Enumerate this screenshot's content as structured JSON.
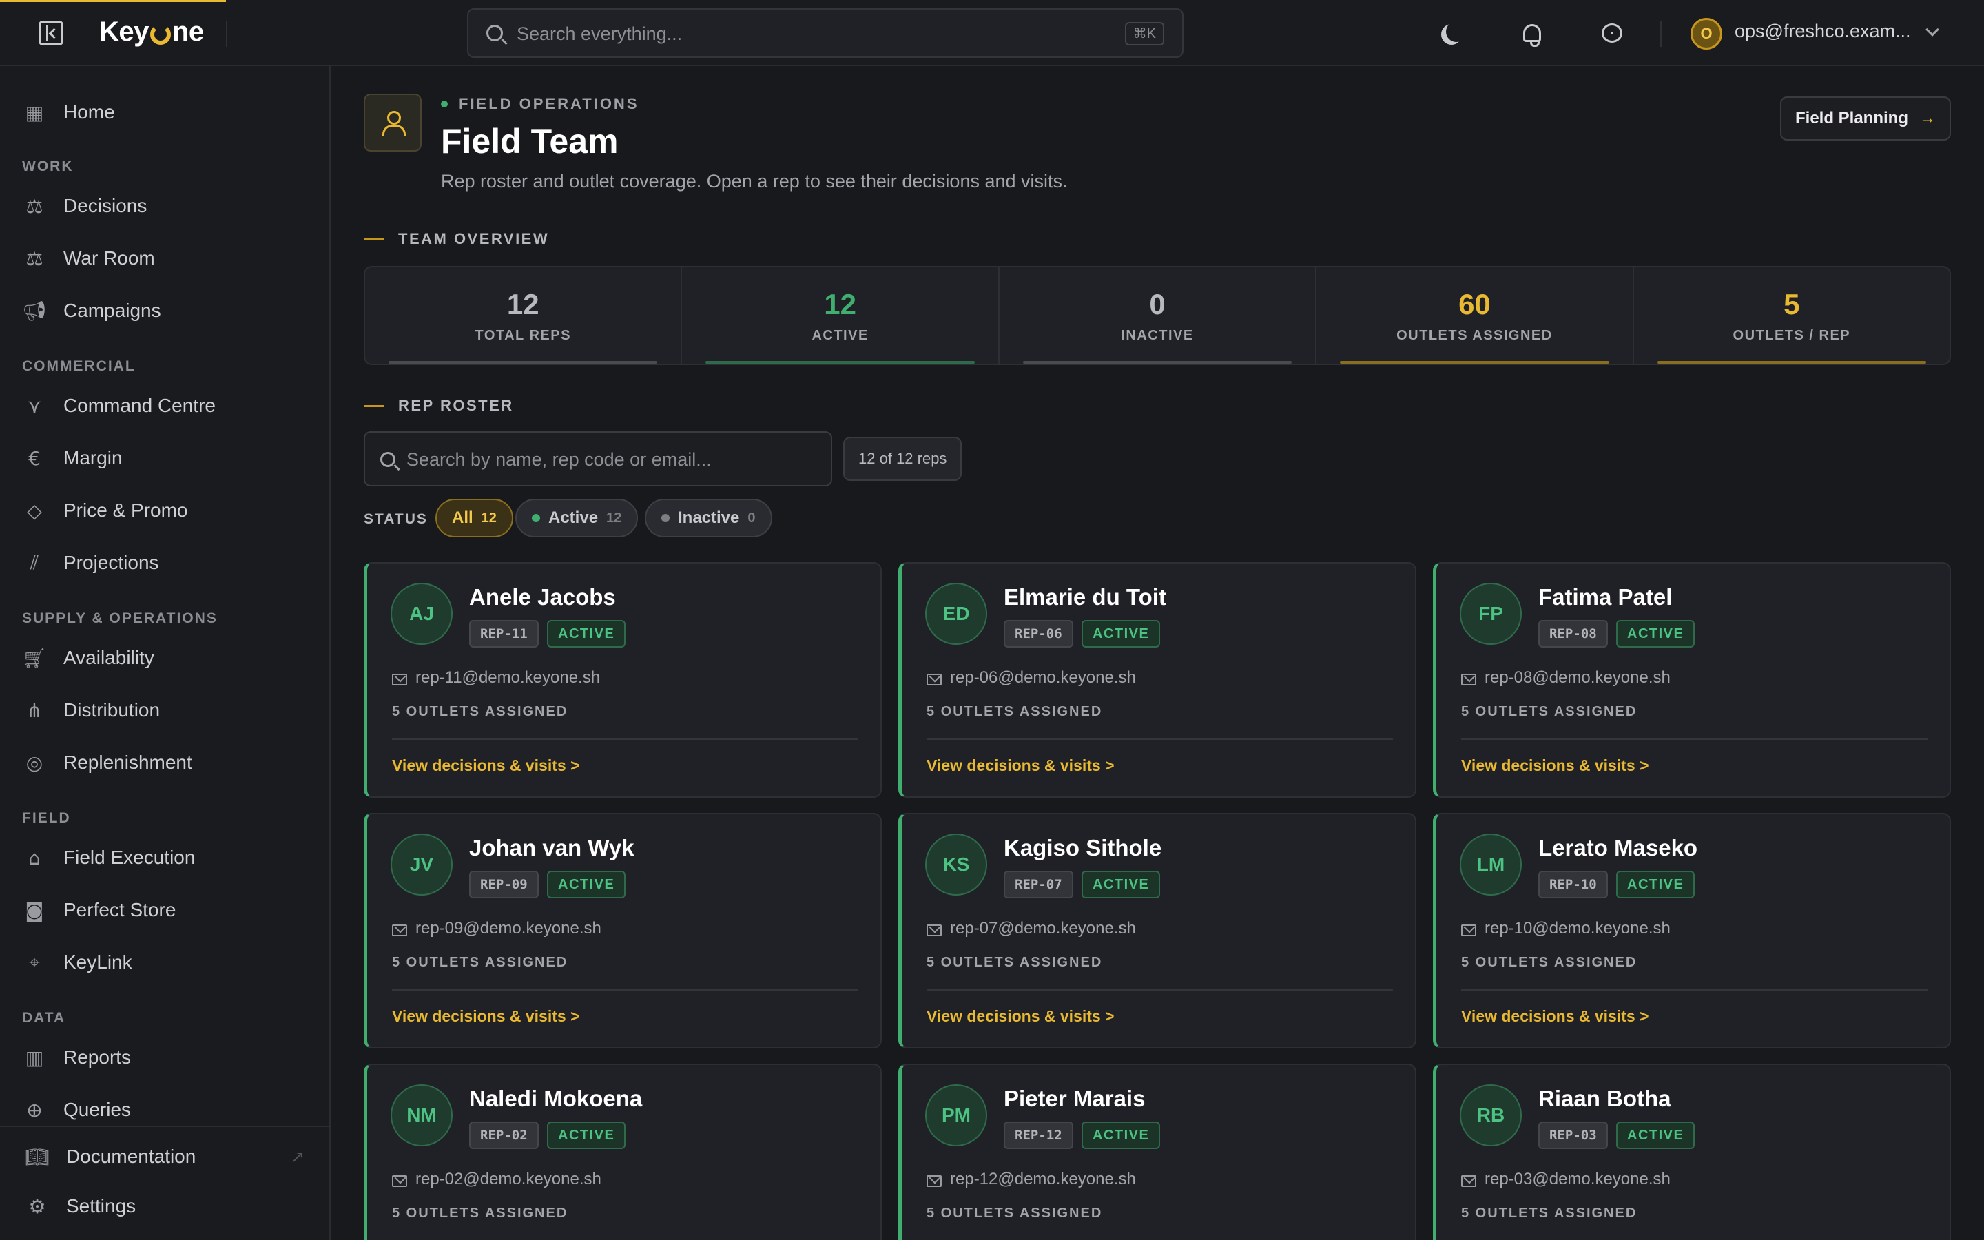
{
  "app": {
    "name_part1": "Key",
    "name_part2": "ne"
  },
  "topbar": {
    "search_placeholder": "Search everything...",
    "shortcut": "⌘K",
    "user_initial": "O",
    "user_email": "ops@freshco.exam..."
  },
  "sidebar": {
    "home": "Home",
    "sections": {
      "work": "WORK",
      "commercial": "COMMERCIAL",
      "supply": "SUPPLY & OPERATIONS",
      "field": "FIELD",
      "data": "DATA"
    },
    "items": {
      "decisions": "Decisions",
      "war_room": "War Room",
      "campaigns": "Campaigns",
      "command_centre": "Command Centre",
      "margin": "Margin",
      "price_promo": "Price & Promo",
      "projections": "Projections",
      "availability": "Availability",
      "distribution": "Distribution",
      "replenishment": "Replenishment",
      "field_execution": "Field Execution",
      "perfect_store": "Perfect Store",
      "keylink": "KeyLink",
      "reports": "Reports",
      "queries": "Queries"
    },
    "bottom": {
      "documentation": "Documentation",
      "settings": "Settings"
    }
  },
  "header": {
    "eyebrow": "FIELD OPERATIONS",
    "title": "Field Team",
    "subtitle": "Rep roster and outlet coverage. Open a rep to see their decisions and visits.",
    "action": "Field Planning"
  },
  "overview": {
    "heading": "TEAM OVERVIEW",
    "stats": [
      {
        "value": "12",
        "label": "TOTAL REPS",
        "color": "#b8b9be"
      },
      {
        "value": "12",
        "label": "ACTIVE",
        "color": "#3fae6f"
      },
      {
        "value": "0",
        "label": "INACTIVE",
        "color": "#b8b9be"
      },
      {
        "value": "60",
        "label": "OUTLETS ASSIGNED",
        "color": "#e8b931"
      },
      {
        "value": "5",
        "label": "OUTLETS / REP",
        "color": "#e8b931"
      }
    ]
  },
  "roster": {
    "heading": "REP ROSTER",
    "search_placeholder": "Search by name, rep code or email...",
    "count": "12 of 12 reps",
    "status_label": "STATUS",
    "filters": [
      {
        "label": "All",
        "count": "12"
      },
      {
        "label": "Active",
        "count": "12"
      },
      {
        "label": "Inactive",
        "count": "0"
      }
    ],
    "view_link": "View decisions & visits",
    "reps": [
      {
        "initials": "AJ",
        "name": "Anele Jacobs",
        "code": "REP-11",
        "status": "ACTIVE",
        "email": "rep-11@demo.keyone.sh",
        "outlets": "5 OUTLETS ASSIGNED"
      },
      {
        "initials": "ED",
        "name": "Elmarie du Toit",
        "code": "REP-06",
        "status": "ACTIVE",
        "email": "rep-06@demo.keyone.sh",
        "outlets": "5 OUTLETS ASSIGNED"
      },
      {
        "initials": "FP",
        "name": "Fatima Patel",
        "code": "REP-08",
        "status": "ACTIVE",
        "email": "rep-08@demo.keyone.sh",
        "outlets": "5 OUTLETS ASSIGNED"
      },
      {
        "initials": "JV",
        "name": "Johan van Wyk",
        "code": "REP-09",
        "status": "ACTIVE",
        "email": "rep-09@demo.keyone.sh",
        "outlets": "5 OUTLETS ASSIGNED"
      },
      {
        "initials": "KS",
        "name": "Kagiso Sithole",
        "code": "REP-07",
        "status": "ACTIVE",
        "email": "rep-07@demo.keyone.sh",
        "outlets": "5 OUTLETS ASSIGNED"
      },
      {
        "initials": "LM",
        "name": "Lerato Maseko",
        "code": "REP-10",
        "status": "ACTIVE",
        "email": "rep-10@demo.keyone.sh",
        "outlets": "5 OUTLETS ASSIGNED"
      },
      {
        "initials": "NM",
        "name": "Naledi Mokoena",
        "code": "REP-02",
        "status": "ACTIVE",
        "email": "rep-02@demo.keyone.sh",
        "outlets": "5 OUTLETS ASSIGNED"
      },
      {
        "initials": "PM",
        "name": "Pieter Marais",
        "code": "REP-12",
        "status": "ACTIVE",
        "email": "rep-12@demo.keyone.sh",
        "outlets": "5 OUTLETS ASSIGNED"
      },
      {
        "initials": "RB",
        "name": "Riaan Botha",
        "code": "REP-03",
        "status": "ACTIVE",
        "email": "rep-03@demo.keyone.sh",
        "outlets": "5 OUTLETS ASSIGNED"
      }
    ]
  }
}
